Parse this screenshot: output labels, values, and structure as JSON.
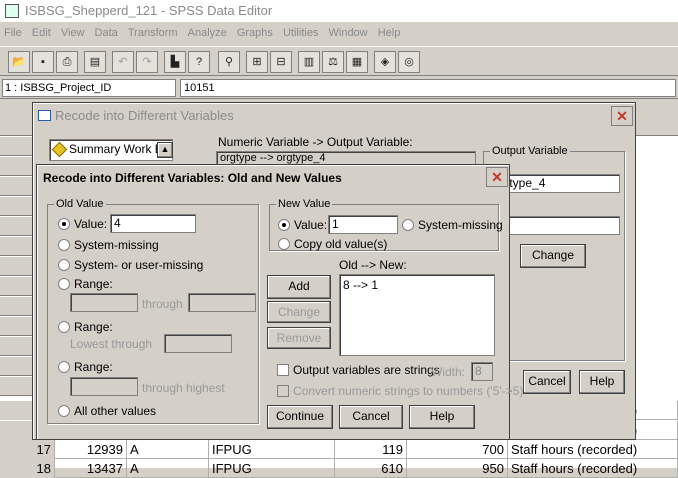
{
  "app": {
    "title": "ISBSG_Shepperd_121 - SPSS Data Editor"
  },
  "menu": [
    "File",
    "Edit",
    "View",
    "Data",
    "Transform",
    "Analyze",
    "Graphs",
    "Utilities",
    "Window",
    "Help"
  ],
  "toolbar": {
    "icons": [
      "open-icon",
      "save-icon",
      "print-icon",
      "dialog-recall-icon",
      "undo-icon",
      "redo-icon",
      "goto-chart-icon",
      "goto-case-icon",
      "variables-icon",
      "find-icon",
      "insert-case-icon",
      "insert-variable-icon",
      "split-file-icon",
      "weight-cases-icon",
      "select-cases-icon",
      "value-labels-icon",
      "use-sets-icon"
    ]
  },
  "cellbar": {
    "ref": "1 : ISBSG_Project_ID",
    "value": "10151"
  },
  "grid": {
    "rows": [
      {
        "num": "",
        "c1": "",
        "c2": "",
        "c3": "",
        "c4": "",
        "c5": "",
        "c6": "Staff hours (recorded)"
      },
      {
        "num": "",
        "c1": "",
        "c2": "",
        "c3": "",
        "c4": "",
        "c5": "",
        "c6": "Staff hours (recorded)"
      },
      {
        "num": "17",
        "c1": "12939",
        "c2": "A",
        "c3": "IFPUG",
        "c4": "119",
        "c5": "700",
        "c6": "Staff hours (recorded)"
      },
      {
        "num": "18",
        "c1": "13437",
        "c2": "A",
        "c3": "IFPUG",
        "c4": "610",
        "c5": "950",
        "c6": "Staff hours (recorded)"
      }
    ]
  },
  "recode_dialog": {
    "title": "Recode into Different Variables",
    "var_list_item": "Summary Work Eff",
    "mapping_label": "Numeric Variable -> Output Variable:",
    "mapping_value": "orgtype --> orgtype_4",
    "output_group": "Output Variable",
    "name_label": "Name:",
    "name_value": "orgtype_4",
    "change_label": "Change",
    "cancel_label": "Cancel",
    "help_label": "Help"
  },
  "oldnew_dialog": {
    "title": "Recode into Different Variables: Old and New Values",
    "old_group": "Old Value",
    "old_value_label": "Value:",
    "old_value": "4",
    "system_missing_label": "System-missing",
    "sys_or_user_missing_label": "System- or user-missing",
    "range_label": "Range:",
    "through_label": "through",
    "lowest_through_label": "Lowest through",
    "through_highest_label": "through highest",
    "all_other_label": "All other values",
    "new_group": "New Value",
    "new_value_label": "Value:",
    "new_value": "1",
    "new_sysmissing_label": "System-missing",
    "copy_old_label": "Copy old value(s)",
    "old_new_label": "Old --> New:",
    "mappings": [
      "8 --> 1"
    ],
    "add_label": "Add",
    "change_label": "Change",
    "remove_label": "Remove",
    "strings_label": "Output variables are strings",
    "width_label": "Width:",
    "width_value": "8",
    "convert_label": "Convert numeric strings to numbers ('5'->5)",
    "continue_label": "Continue",
    "cancel_label": "Cancel",
    "help_label": "Help"
  }
}
